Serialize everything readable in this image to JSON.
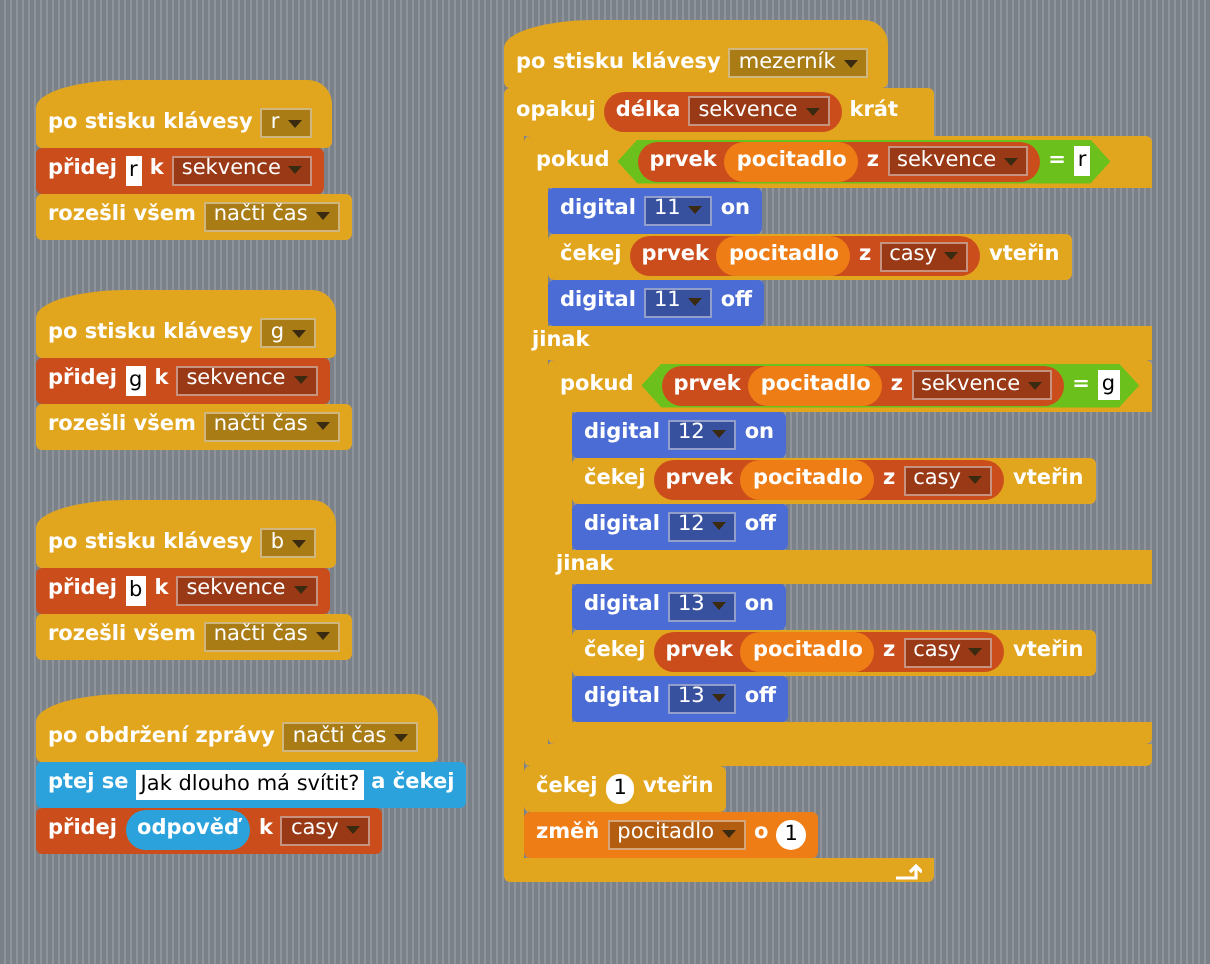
{
  "scripts": [
    {
      "blocks": [
        {
          "kind": "hat",
          "color": "#e2a61e",
          "parts": [
            {
              "kind": "text",
              "text": "po stisku klávesy"
            },
            {
              "kind": "dropdown",
              "value": "r"
            }
          ]
        },
        {
          "kind": "stack",
          "color": "#cc4d1c",
          "parts": [
            {
              "kind": "text",
              "text": "přidej"
            },
            {
              "kind": "input",
              "value": "r"
            },
            {
              "kind": "text",
              "text": "k"
            },
            {
              "kind": "dropdown",
              "value": "sekvence"
            }
          ]
        },
        {
          "kind": "stack",
          "color": "#e2a61e",
          "parts": [
            {
              "kind": "text",
              "text": "rozešli všem"
            },
            {
              "kind": "dropdown",
              "value": "načti čas"
            }
          ]
        }
      ]
    },
    {
      "blocks": [
        {
          "kind": "hat",
          "color": "#e2a61e",
          "parts": [
            {
              "kind": "text",
              "text": "po stisku klávesy"
            },
            {
              "kind": "dropdown",
              "value": "g"
            }
          ]
        },
        {
          "kind": "stack",
          "color": "#cc4d1c",
          "parts": [
            {
              "kind": "text",
              "text": "přidej"
            },
            {
              "kind": "input",
              "value": "g"
            },
            {
              "kind": "text",
              "text": "k"
            },
            {
              "kind": "dropdown",
              "value": "sekvence"
            }
          ]
        },
        {
          "kind": "stack",
          "color": "#e2a61e",
          "parts": [
            {
              "kind": "text",
              "text": "rozešli všem"
            },
            {
              "kind": "dropdown",
              "value": "načti čas"
            }
          ]
        }
      ]
    },
    {
      "blocks": [
        {
          "kind": "hat",
          "color": "#e2a61e",
          "parts": [
            {
              "kind": "text",
              "text": "po stisku klávesy"
            },
            {
              "kind": "dropdown",
              "value": "b"
            }
          ]
        },
        {
          "kind": "stack",
          "color": "#cc4d1c",
          "parts": [
            {
              "kind": "text",
              "text": "přidej"
            },
            {
              "kind": "input",
              "value": "b"
            },
            {
              "kind": "text",
              "text": "k"
            },
            {
              "kind": "dropdown",
              "value": "sekvence"
            }
          ]
        },
        {
          "kind": "stack",
          "color": "#e2a61e",
          "parts": [
            {
              "kind": "text",
              "text": "rozešli všem"
            },
            {
              "kind": "dropdown",
              "value": "načti čas"
            }
          ]
        }
      ]
    },
    {
      "blocks": [
        {
          "kind": "hat",
          "color": "#e2a61e",
          "parts": [
            {
              "kind": "text",
              "text": "po obdržení zprávy"
            },
            {
              "kind": "dropdown",
              "value": "načti čas"
            }
          ]
        },
        {
          "kind": "stack",
          "color": "#2ca2dc",
          "parts": [
            {
              "kind": "text",
              "text": "ptej se"
            },
            {
              "kind": "input",
              "value": "Jak dlouho má svítit?"
            },
            {
              "kind": "text",
              "text": "a čekej"
            }
          ]
        },
        {
          "kind": "stack",
          "color": "#cc4d1c",
          "parts": [
            {
              "kind": "text",
              "text": "přidej"
            },
            {
              "kind": "reporter",
              "color": "#2ca2dc",
              "parts": [
                {
                  "kind": "text",
                  "text": "odpověď"
                }
              ]
            },
            {
              "kind": "text",
              "text": "k"
            },
            {
              "kind": "dropdown",
              "value": "casy"
            }
          ]
        }
      ]
    },
    {
      "blocks": [
        {
          "kind": "hat",
          "color": "#e2a61e",
          "parts": [
            {
              "kind": "text",
              "text": "po stisku klávesy"
            },
            {
              "kind": "dropdown",
              "value": "mezerník"
            }
          ]
        },
        {
          "kind": "repeat",
          "color": "#e2a61e",
          "parts": [
            {
              "kind": "text",
              "text": "opakuj"
            },
            {
              "kind": "reporter",
              "color": "#cc4d1c",
              "parts": [
                {
                  "kind": "text",
                  "text": "délka"
                },
                {
                  "kind": "dropdown",
                  "value": "sekvence"
                }
              ]
            },
            {
              "kind": "text",
              "text": "krát"
            }
          ],
          "children": [
            {
              "kind": "if_else",
              "color": "#e2a61e",
              "parts": [
                {
                  "kind": "text",
                  "text": "pokud"
                },
                {
                  "kind": "boolean",
                  "color": "#6cc01c",
                  "parts": [
                    {
                      "kind": "reporter",
                      "color": "#cc4d1c",
                      "parts": [
                        {
                          "kind": "text",
                          "text": "prvek"
                        },
                        {
                          "kind": "reporter",
                          "color": "#ee7d16",
                          "parts": [
                            {
                              "kind": "text",
                              "text": "pocitadlo"
                            }
                          ]
                        },
                        {
                          "kind": "text",
                          "text": "z"
                        },
                        {
                          "kind": "dropdown",
                          "value": "sekvence"
                        }
                      ]
                    },
                    {
                      "kind": "text",
                      "text": "="
                    },
                    {
                      "kind": "input",
                      "value": "r"
                    }
                  ]
                }
              ],
              "children": [
                {
                  "kind": "stack",
                  "color": "#4a6cd4",
                  "parts": [
                    {
                      "kind": "text",
                      "text": "digital"
                    },
                    {
                      "kind": "dropdown",
                      "value": "11"
                    },
                    {
                      "kind": "text",
                      "text": "on"
                    }
                  ]
                },
                {
                  "kind": "stack",
                  "color": "#e2a61e",
                  "parts": [
                    {
                      "kind": "text",
                      "text": "čekej"
                    },
                    {
                      "kind": "reporter",
                      "color": "#cc4d1c",
                      "parts": [
                        {
                          "kind": "text",
                          "text": "prvek"
                        },
                        {
                          "kind": "reporter",
                          "color": "#ee7d16",
                          "parts": [
                            {
                              "kind": "text",
                              "text": "pocitadlo"
                            }
                          ]
                        },
                        {
                          "kind": "text",
                          "text": "z"
                        },
                        {
                          "kind": "dropdown",
                          "value": "casy"
                        }
                      ]
                    },
                    {
                      "kind": "text",
                      "text": "vteřin"
                    }
                  ]
                },
                {
                  "kind": "stack",
                  "color": "#4a6cd4",
                  "parts": [
                    {
                      "kind": "text",
                      "text": "digital"
                    },
                    {
                      "kind": "dropdown",
                      "value": "11"
                    },
                    {
                      "kind": "text",
                      "text": "off"
                    }
                  ]
                }
              ],
              "else_label": "jinak",
              "else_children": [
                {
                  "kind": "if_else",
                  "color": "#e2a61e",
                  "parts": [
                    {
                      "kind": "text",
                      "text": "pokud"
                    },
                    {
                      "kind": "boolean",
                      "color": "#6cc01c",
                      "parts": [
                        {
                          "kind": "reporter",
                          "color": "#cc4d1c",
                          "parts": [
                            {
                              "kind": "text",
                              "text": "prvek"
                            },
                            {
                              "kind": "reporter",
                              "color": "#ee7d16",
                              "parts": [
                                {
                                  "kind": "text",
                                  "text": "pocitadlo"
                                }
                              ]
                            },
                            {
                              "kind": "text",
                              "text": "z"
                            },
                            {
                              "kind": "dropdown",
                              "value": "sekvence"
                            }
                          ]
                        },
                        {
                          "kind": "text",
                          "text": "="
                        },
                        {
                          "kind": "input",
                          "value": "g"
                        }
                      ]
                    }
                  ],
                  "children": [
                    {
                      "kind": "stack",
                      "color": "#4a6cd4",
                      "parts": [
                        {
                          "kind": "text",
                          "text": "digital"
                        },
                        {
                          "kind": "dropdown",
                          "value": "12"
                        },
                        {
                          "kind": "text",
                          "text": "on"
                        }
                      ]
                    },
                    {
                      "kind": "stack",
                      "color": "#e2a61e",
                      "parts": [
                        {
                          "kind": "text",
                          "text": "čekej"
                        },
                        {
                          "kind": "reporter",
                          "color": "#cc4d1c",
                          "parts": [
                            {
                              "kind": "text",
                              "text": "prvek"
                            },
                            {
                              "kind": "reporter",
                              "color": "#ee7d16",
                              "parts": [
                                {
                                  "kind": "text",
                                  "text": "pocitadlo"
                                }
                              ]
                            },
                            {
                              "kind": "text",
                              "text": "z"
                            },
                            {
                              "kind": "dropdown",
                              "value": "casy"
                            }
                          ]
                        },
                        {
                          "kind": "text",
                          "text": "vteřin"
                        }
                      ]
                    },
                    {
                      "kind": "stack",
                      "color": "#4a6cd4",
                      "parts": [
                        {
                          "kind": "text",
                          "text": "digital"
                        },
                        {
                          "kind": "dropdown",
                          "value": "12"
                        },
                        {
                          "kind": "text",
                          "text": "off"
                        }
                      ]
                    }
                  ],
                  "else_label": "jinak",
                  "else_children": [
                    {
                      "kind": "stack",
                      "color": "#4a6cd4",
                      "parts": [
                        {
                          "kind": "text",
                          "text": "digital"
                        },
                        {
                          "kind": "dropdown",
                          "value": "13"
                        },
                        {
                          "kind": "text",
                          "text": "on"
                        }
                      ]
                    },
                    {
                      "kind": "stack",
                      "color": "#e2a61e",
                      "parts": [
                        {
                          "kind": "text",
                          "text": "čekej"
                        },
                        {
                          "kind": "reporter",
                          "color": "#cc4d1c",
                          "parts": [
                            {
                              "kind": "text",
                              "text": "prvek"
                            },
                            {
                              "kind": "reporter",
                              "color": "#ee7d16",
                              "parts": [
                                {
                                  "kind": "text",
                                  "text": "pocitadlo"
                                }
                              ]
                            },
                            {
                              "kind": "text",
                              "text": "z"
                            },
                            {
                              "kind": "dropdown",
                              "value": "casy"
                            }
                          ]
                        },
                        {
                          "kind": "text",
                          "text": "vteřin"
                        }
                      ]
                    },
                    {
                      "kind": "stack",
                      "color": "#4a6cd4",
                      "parts": [
                        {
                          "kind": "text",
                          "text": "digital"
                        },
                        {
                          "kind": "dropdown",
                          "value": "13"
                        },
                        {
                          "kind": "text",
                          "text": "off"
                        }
                      ]
                    }
                  ]
                }
              ]
            },
            {
              "kind": "stack",
              "color": "#e2a61e",
              "parts": [
                {
                  "kind": "text",
                  "text": "čekej"
                },
                {
                  "kind": "number",
                  "value": "1"
                },
                {
                  "kind": "text",
                  "text": "vteřin"
                }
              ]
            },
            {
              "kind": "stack",
              "color": "#ee7d16",
              "parts": [
                {
                  "kind": "text",
                  "text": "změň"
                },
                {
                  "kind": "dropdown",
                  "value": "pocitadlo"
                },
                {
                  "kind": "text",
                  "text": "o"
                },
                {
                  "kind": "number",
                  "value": "1"
                }
              ]
            }
          ]
        }
      ]
    }
  ]
}
